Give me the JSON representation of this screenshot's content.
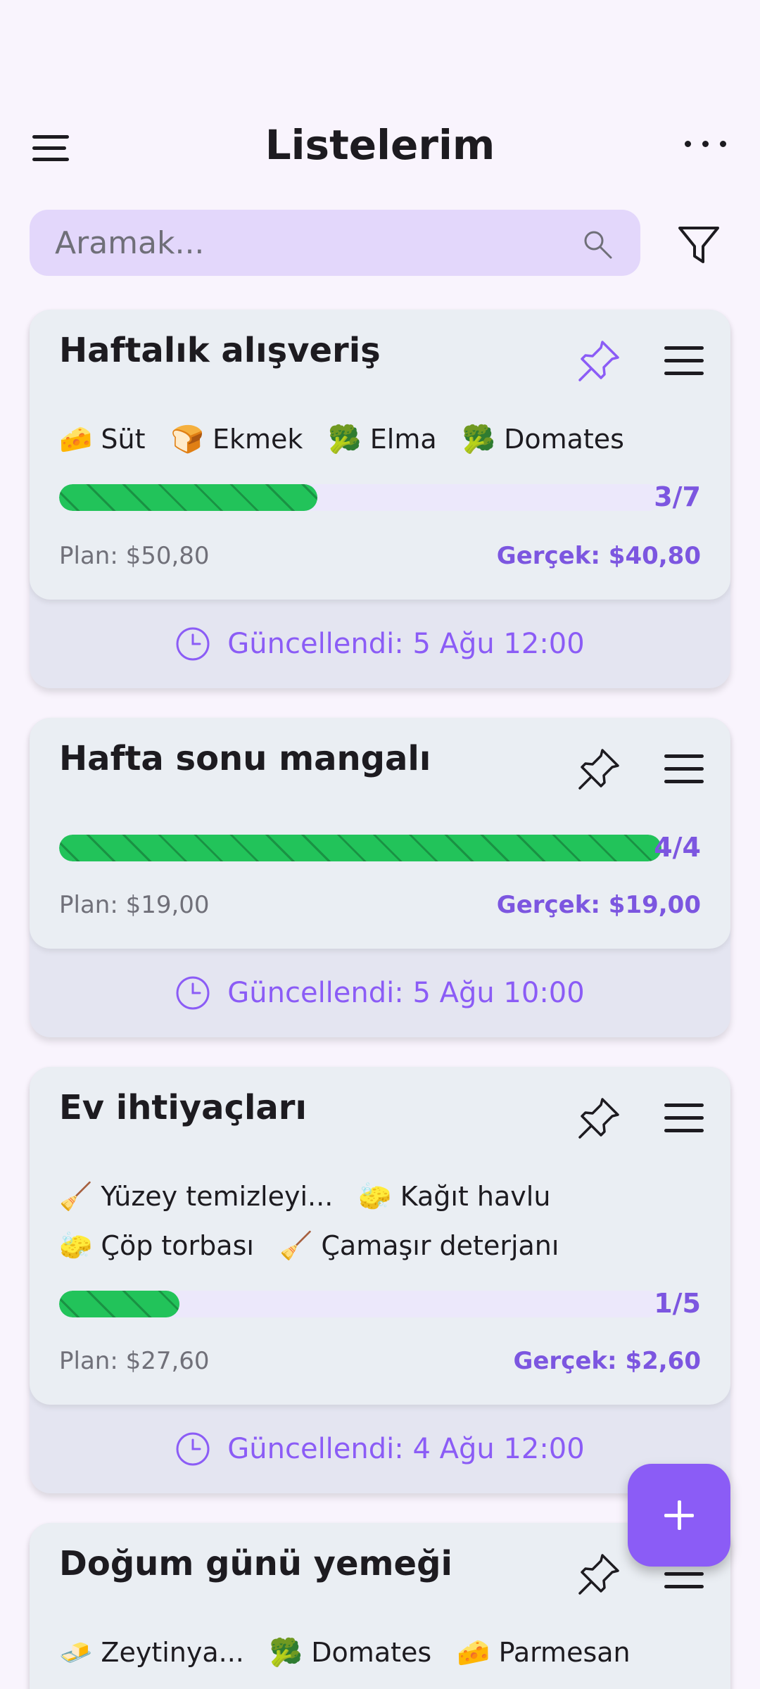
{
  "header": {
    "title": "Listelerim",
    "menu_icon": "hamburger-menu-icon",
    "more_icon": "more-horizontal-icon"
  },
  "search": {
    "placeholder": "Aramak...",
    "value": "",
    "icon": "search-icon"
  },
  "filter": {
    "icon": "filter-icon"
  },
  "lists": [
    {
      "title": "Haftalık alışveriş",
      "pinned": true,
      "chips": [
        {
          "emoji": "🧀",
          "label": "Süt"
        },
        {
          "emoji": "🍞",
          "label": "Ekmek"
        },
        {
          "emoji": "🥦",
          "label": "Elma"
        },
        {
          "emoji": "🥦",
          "label": "Domates"
        }
      ],
      "progress": {
        "done": 3,
        "total": 7,
        "label": "3/7"
      },
      "plan": "Plan: $50,80",
      "actual": "Gerçek: $40,80",
      "updated": "Güncellendi: 5 Ağu 12:00"
    },
    {
      "title": "Hafta sonu mangalı",
      "pinned": false,
      "chips": [],
      "progress": {
        "done": 4,
        "total": 4,
        "label": "4/4"
      },
      "plan": "Plan: $19,00",
      "actual": "Gerçek: $19,00",
      "updated": "Güncellendi: 5 Ağu 10:00"
    },
    {
      "title": "Ev ihtiyaçları",
      "pinned": false,
      "chips": [
        {
          "emoji": "🧹",
          "label": "Yüzey temizleyi..."
        },
        {
          "emoji": "🧽",
          "label": "Kağıt havlu"
        },
        {
          "emoji": "🧽",
          "label": "Çöp torbası"
        },
        {
          "emoji": "🧹",
          "label": "Çamaşır deterjanı"
        }
      ],
      "progress": {
        "done": 1,
        "total": 5,
        "label": "1/5"
      },
      "plan": "Plan: $27,60",
      "actual": "Gerçek: $2,60",
      "updated": "Güncellendi: 4 Ağu 12:00"
    },
    {
      "title": "Doğum günü yemeği",
      "pinned": false,
      "chips": [
        {
          "emoji": "🧈",
          "label": "Zeytinya..."
        },
        {
          "emoji": "🥦",
          "label": "Domates"
        },
        {
          "emoji": "🧀",
          "label": "Parmesan"
        }
      ]
    }
  ],
  "fab": {
    "label": "+",
    "icon": "add-icon"
  },
  "colors": {
    "accent": "#8b5cf6",
    "progress": "#22c35a",
    "search_bg": "#e3d7fb",
    "background": "#f9f4fd"
  }
}
